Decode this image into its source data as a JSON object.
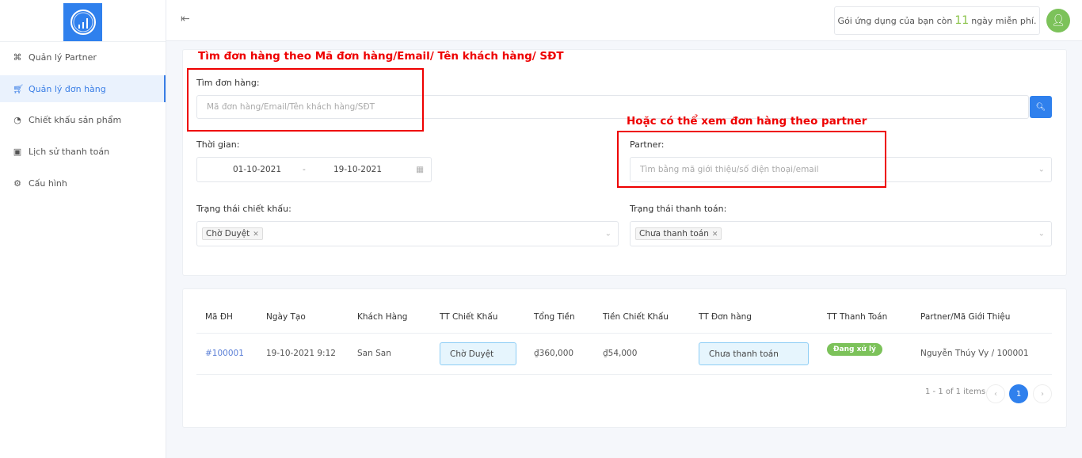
{
  "sidebar": {
    "items": [
      {
        "label": "Quản lý Partner",
        "icon": "sitemap-icon"
      },
      {
        "label": "Quản lý đơn hàng",
        "icon": "cart-icon",
        "active": true
      },
      {
        "label": "Chiết khấu sản phẩm",
        "icon": "pie-chart-icon"
      },
      {
        "label": "Lịch sử thanh toán",
        "icon": "wallet-icon"
      },
      {
        "label": "Cấu hình",
        "icon": "gear-icon"
      }
    ]
  },
  "header": {
    "trial_prefix": "Gói ứng dụng của bạn còn",
    "trial_days": "11",
    "trial_suffix": "ngày miễn phí."
  },
  "annotations": {
    "search": "Tìm đơn hàng theo Mã đơn hàng/Email/ Tên khách hàng/ SĐT",
    "partner": "Hoặc có thể xem đơn hàng theo partner"
  },
  "filters": {
    "search_label": "Tìm đơn hàng:",
    "search_placeholder": "Mã đơn hàng/Email/Tên khách hàng/SĐT",
    "time_label": "Thời gian:",
    "date_from": "01-10-2021",
    "date_sep": "-",
    "date_to": "19-10-2021",
    "partner_label": "Partner:",
    "partner_placeholder": "Tìm bằng mã giới thiệu/số điện thoại/email",
    "discount_status_label": "Trạng thái chiết khấu:",
    "discount_status_tag": "Chờ Duyệt",
    "payment_status_label": "Trạng thái thanh toán:",
    "payment_status_tag": "Chưa thanh toán"
  },
  "table": {
    "headers": [
      "Mã ĐH",
      "Ngày Tạo",
      "Khách Hàng",
      "TT Chiết Khấu",
      "Tổng Tiền",
      "Tiền Chiết Khấu",
      "TT Đơn hàng",
      "TT Thanh Toán",
      "Partner/Mã Giới Thiệu"
    ],
    "rows": [
      {
        "id": "#100001",
        "date": "19-10-2021 9:12",
        "customer": "San San",
        "discount_status": "Chờ Duyệt",
        "total": "₫360,000",
        "discount": "₫54,000",
        "order_status": "Chưa thanh toán",
        "payment_status": "Đang xử lý",
        "partner": "Nguyễn Thúy Vy / 100001"
      }
    ]
  },
  "pagination": {
    "summary": "1 - 1 of 1 items",
    "current": "1"
  },
  "colors": {
    "primary": "#2f80ed",
    "success": "#7cc25a",
    "annotation": "#ee0000"
  }
}
